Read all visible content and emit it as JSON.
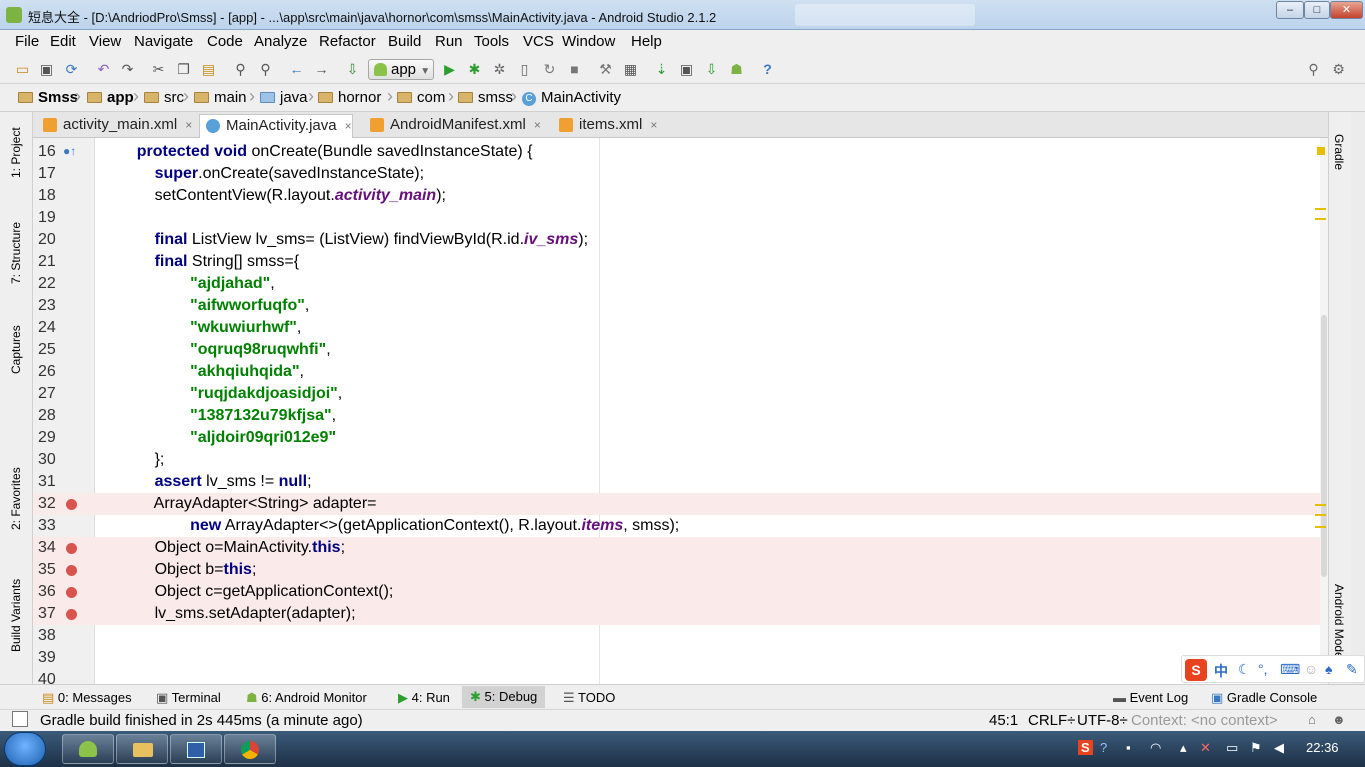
{
  "window": {
    "title": "短息大全 - [D:\\AndriodPro\\Smss] - [app] - ...\\app\\src\\main\\java\\hornor\\com\\smss\\MainActivity.java - Android Studio 2.1.2",
    "minimize": "–",
    "maximize": "□",
    "close": "✕"
  },
  "menu": [
    "File",
    "Edit",
    "View",
    "Navigate",
    "Code",
    "Analyze",
    "Refactor",
    "Build",
    "Run",
    "Tools",
    "VCS",
    "Window",
    "Help"
  ],
  "toolbar": {
    "run_config": "app",
    "icons": [
      "open-icon",
      "save-icon",
      "sync-icon",
      "undo-icon",
      "redo-icon",
      "cut-icon",
      "copy-icon",
      "paste-icon",
      "find-icon",
      "replace-icon",
      "back-icon",
      "forward-icon",
      "make-icon",
      "run-icon",
      "debug-icon",
      "attach-icon",
      "profile-icon",
      "rerun-icon",
      "stop-icon",
      "sdk-icon",
      "structure-icon",
      "gradle-sync-icon",
      "avd-icon",
      "device-icon",
      "android-icon",
      "help-icon",
      "search-icon",
      "settings-icon"
    ]
  },
  "breadcrumbs": [
    "Smss",
    "app",
    "src",
    "main",
    "java",
    "hornor",
    "com",
    "smss",
    "MainActivity"
  ],
  "tabs": [
    {
      "label": "activity_main.xml",
      "close": "×"
    },
    {
      "label": "MainActivity.java",
      "close": "×"
    },
    {
      "label": "AndroidManifest.xml",
      "close": "×"
    },
    {
      "label": "items.xml",
      "close": "×"
    }
  ],
  "left_tools": [
    "1: Project",
    "7: Structure",
    "Captures",
    "2: Favorites",
    "Build Variants"
  ],
  "right_tools": [
    "Gradle",
    "Android Model"
  ],
  "code_lines": [
    {
      "n": "16",
      "segs": [
        {
          "t": "    "
        },
        {
          "t": "protected void",
          "c": "kw"
        },
        {
          "t": " onCreate(Bundle savedInstanceState) {"
        }
      ]
    },
    {
      "n": "17",
      "segs": [
        {
          "t": "        "
        },
        {
          "t": "super",
          "c": "kw"
        },
        {
          "t": ".onCreate(savedInstanceState);"
        }
      ]
    },
    {
      "n": "18",
      "segs": [
        {
          "t": "        setContentView(R.layout."
        },
        {
          "t": "activity_main",
          "c": "fld"
        },
        {
          "t": ");"
        }
      ]
    },
    {
      "n": "19",
      "segs": []
    },
    {
      "n": "20",
      "segs": [
        {
          "t": "        "
        },
        {
          "t": "final",
          "c": "kw"
        },
        {
          "t": " ListView lv_sms= (ListView) findViewById(R.id."
        },
        {
          "t": "iv_sms",
          "c": "fld"
        },
        {
          "t": ");"
        }
      ]
    },
    {
      "n": "21",
      "segs": [
        {
          "t": "        "
        },
        {
          "t": "final",
          "c": "kw"
        },
        {
          "t": " String[] smss={"
        }
      ]
    },
    {
      "n": "22",
      "segs": [
        {
          "t": "                "
        },
        {
          "t": "\"ajdjahad\"",
          "c": "str"
        },
        {
          "t": ","
        }
      ]
    },
    {
      "n": "23",
      "segs": [
        {
          "t": "                "
        },
        {
          "t": "\"aifwworfuqfo\"",
          "c": "str"
        },
        {
          "t": ","
        }
      ]
    },
    {
      "n": "24",
      "segs": [
        {
          "t": "                "
        },
        {
          "t": "\"wkuwiurhwf\"",
          "c": "str"
        },
        {
          "t": ","
        }
      ]
    },
    {
      "n": "25",
      "segs": [
        {
          "t": "                "
        },
        {
          "t": "\"oqruq98ruqwhfi\"",
          "c": "str"
        },
        {
          "t": ","
        }
      ]
    },
    {
      "n": "26",
      "segs": [
        {
          "t": "                "
        },
        {
          "t": "\"akhqiuhqida\"",
          "c": "str"
        },
        {
          "t": ","
        }
      ]
    },
    {
      "n": "27",
      "segs": [
        {
          "t": "                "
        },
        {
          "t": "\"ruqjdakdjoasidjoi\"",
          "c": "str"
        },
        {
          "t": ","
        }
      ]
    },
    {
      "n": "28",
      "segs": [
        {
          "t": "                "
        },
        {
          "t": "\"1387132u79kfjsa\"",
          "c": "str"
        },
        {
          "t": ","
        }
      ]
    },
    {
      "n": "29",
      "segs": [
        {
          "t": "                "
        },
        {
          "t": "\"aljdoir09qri012e9\"",
          "c": "str"
        }
      ]
    },
    {
      "n": "30",
      "segs": [
        {
          "t": "        };"
        }
      ]
    },
    {
      "n": "31",
      "segs": [
        {
          "t": "        "
        },
        {
          "t": "assert",
          "c": "kw"
        },
        {
          "t": " lv_sms != "
        },
        {
          "t": "null",
          "c": "kw"
        },
        {
          "t": ";"
        }
      ]
    },
    {
      "n": "32",
      "bp": true,
      "segs": [
        {
          "t": "        ArrayAdapter<String> adapter="
        }
      ]
    },
    {
      "n": "33",
      "segs": [
        {
          "t": "                "
        },
        {
          "t": "new",
          "c": "kw"
        },
        {
          "t": " ArrayAdapter<>(getApplicationContext(), R.layout."
        },
        {
          "t": "items",
          "c": "fld"
        },
        {
          "t": ", smss);"
        }
      ]
    },
    {
      "n": "34",
      "bp": true,
      "segs": [
        {
          "t": "        Object o=MainActivity."
        },
        {
          "t": "this",
          "c": "kw"
        },
        {
          "t": ";"
        }
      ]
    },
    {
      "n": "35",
      "bp": true,
      "segs": [
        {
          "t": "        Object b="
        },
        {
          "t": "this",
          "c": "kw"
        },
        {
          "t": ";"
        }
      ]
    },
    {
      "n": "36",
      "bp": true,
      "segs": [
        {
          "t": "        Object c=getApplicationContext();"
        }
      ]
    },
    {
      "n": "37",
      "bp": true,
      "segs": [
        {
          "t": "        lv_sms.setAdapter(adapter);"
        }
      ]
    },
    {
      "n": "38",
      "segs": []
    },
    {
      "n": "39",
      "segs": []
    },
    {
      "n": "40",
      "segs": []
    }
  ],
  "bottom_tools": {
    "messages": "0: Messages",
    "terminal": "Terminal",
    "android_monitor": "6: Android Monitor",
    "run": "4: Run",
    "debug": "5: Debug",
    "todo": "TODO",
    "event_log": "Event Log",
    "gradle_console": "Gradle Console"
  },
  "status": {
    "message": "Gradle build finished in 2s 445ms (a minute ago)",
    "position": "45:1",
    "line_sep": "CRLF÷",
    "encoding": "UTF-8÷",
    "context": "Context: <no context>"
  },
  "taskbar": {
    "clock": "22:36"
  },
  "colors": {
    "keyword": "#000080",
    "string": "#008000",
    "field": "#660e7a",
    "breakpoint_line": "#faeaea",
    "breakpoint": "#d9534f"
  }
}
